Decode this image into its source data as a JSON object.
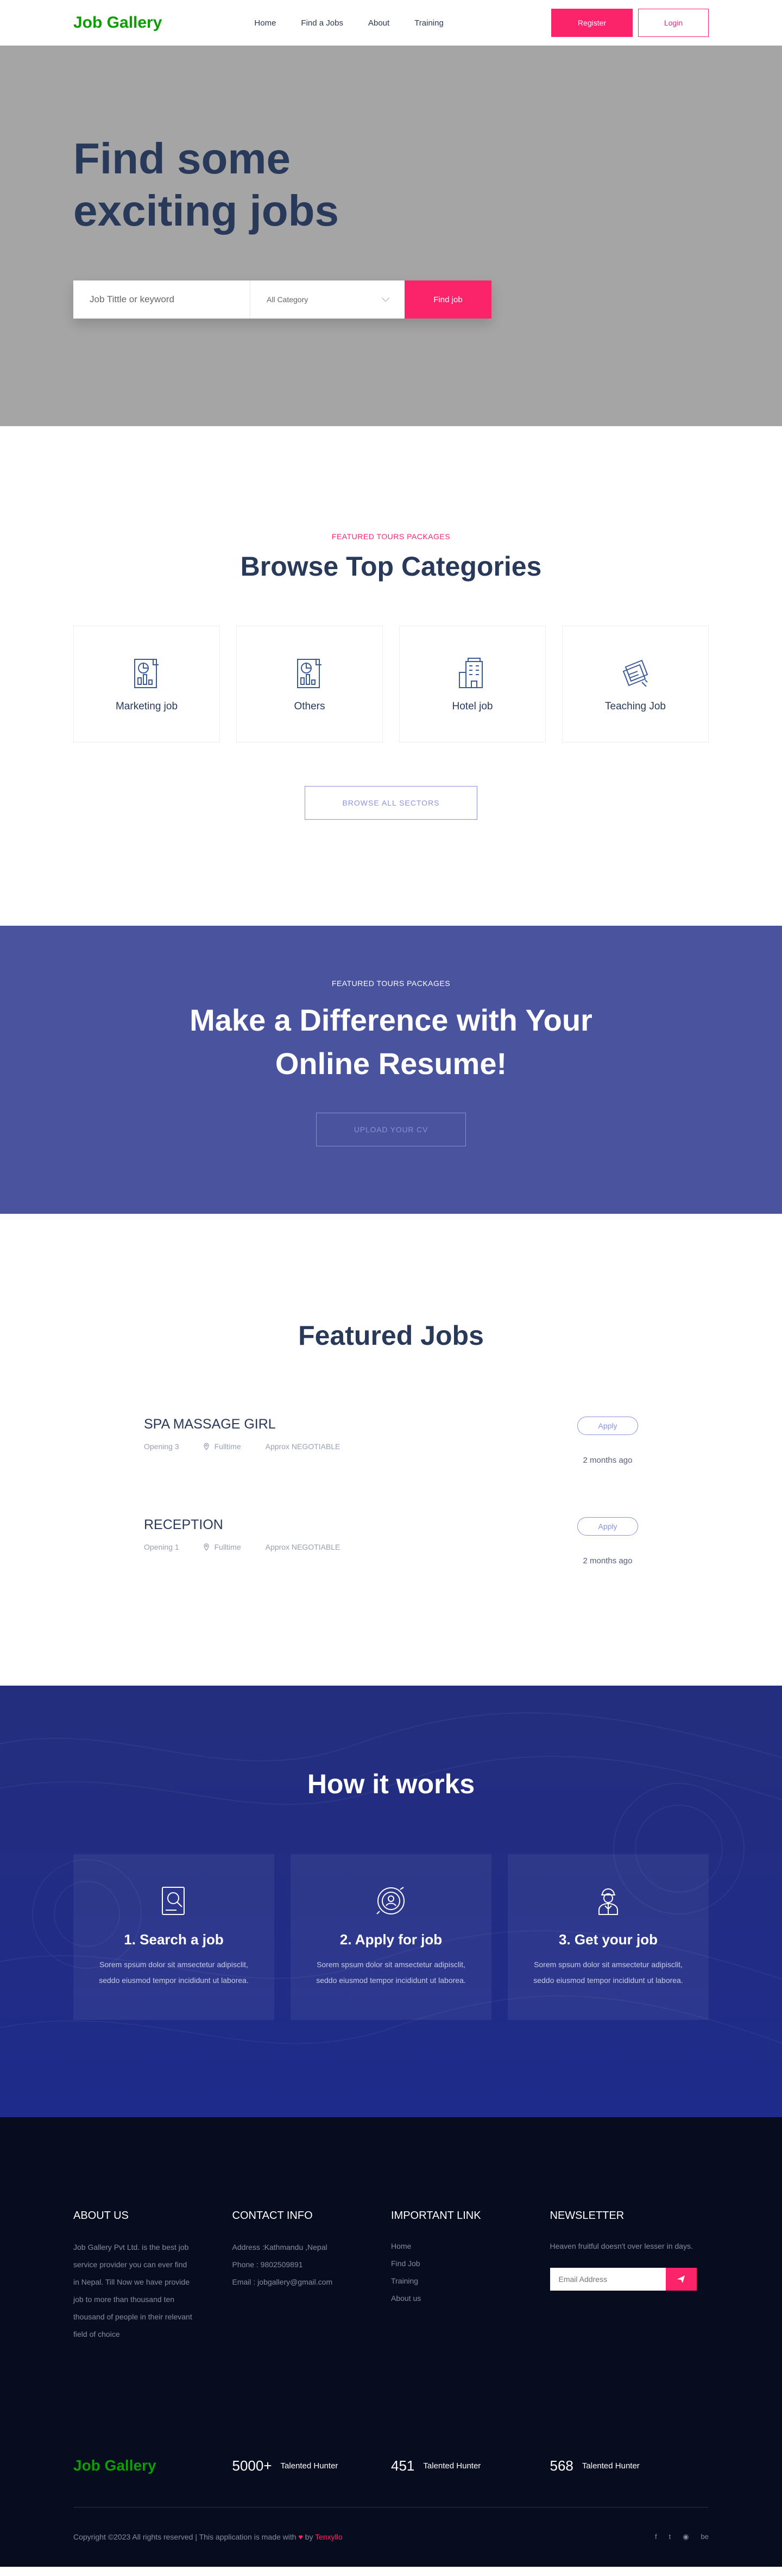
{
  "header": {
    "logo": "Job Gallery",
    "nav": [
      "Home",
      "Find a Jobs",
      "About",
      "Training"
    ],
    "register": "Register",
    "login": "Login"
  },
  "hero": {
    "title_line1": "Find some",
    "title_line2": "exciting jobs",
    "search_placeholder": "Job Tittle or keyword",
    "category_selected": "All Category",
    "find_button": "Find job"
  },
  "categories": {
    "eyebrow": "FEATURED TOURS PACKAGES",
    "title": "Browse Top Categories",
    "items": [
      {
        "label": "Marketing job",
        "icon": "report-icon"
      },
      {
        "label": "Others",
        "icon": "report-icon"
      },
      {
        "label": "Hotel job",
        "icon": "hotel-icon"
      },
      {
        "label": "Teaching Job",
        "icon": "documents-icon"
      }
    ],
    "browse_button": "BROWSE ALL SECTORS"
  },
  "cta": {
    "eyebrow": "FEATURED TOURS PACKAGES",
    "title_line1": "Make a Difference with Your",
    "title_line2": "Online Resume!",
    "upload_button": "UPLOAD YOUR CV"
  },
  "featured": {
    "title": "Featured Jobs",
    "jobs": [
      {
        "title": "SPA MASSAGE GIRL",
        "opening": "Opening 3",
        "type": "Fulltime",
        "salary": "Approx NEGOTIABLE",
        "apply": "Apply",
        "time": "2 months ago"
      },
      {
        "title": "RECEPTION",
        "opening": "Opening 1",
        "type": "Fulltime",
        "salary": "Approx NEGOTIABLE",
        "apply": "Apply",
        "time": "2 months ago"
      }
    ]
  },
  "how": {
    "title": "How it works",
    "steps": [
      {
        "title": "1. Search a job",
        "text": "Sorem spsum dolor sit amsectetur adipisclit, seddo eiusmod tempor incididunt ut laborea.",
        "icon": "search-doc-icon"
      },
      {
        "title": "2. Apply for job",
        "text": "Sorem spsum dolor sit amsectetur adipisclit, seddo eiusmod tempor incididunt ut laborea.",
        "icon": "apply-icon"
      },
      {
        "title": "3. Get your job",
        "text": "Sorem spsum dolor sit amsectetur adipisclit, seddo eiusmod tempor incididunt ut laborea.",
        "icon": "worker-icon"
      }
    ]
  },
  "footer": {
    "about_title": "ABOUT US",
    "about_text": "Job Gallery Pvt Ltd. is the best job service provider you can ever find in Nepal. Till Now we have provide job to more than thousand ten thousand of people in their relevant field of choice",
    "contact_title": "CONTACT INFO",
    "address": "Address :Kathmandu ,Nepal",
    "phone": "Phone : 9802509891",
    "email": "Email : jobgallery@gmail.com",
    "links_title": "IMPORTANT LINK",
    "links": [
      "Home",
      "Find Job",
      "Training",
      "About us"
    ],
    "newsletter_title": "NEWSLETTER",
    "newsletter_text": "Heaven fruitful doesn't over lesser in days.",
    "email_placeholder": "Email Address",
    "logo": "Job Gallery",
    "stats": [
      {
        "num": "5000+",
        "label": "Talented Hunter"
      },
      {
        "num": "451",
        "label": "Talented Hunter"
      },
      {
        "num": "568",
        "label": "Talented Hunter"
      }
    ],
    "copyright": "Copyright ©2023 All rights reserved | This application is made with",
    "by": "by",
    "brand": "Tenxyllo",
    "social": [
      "f",
      "t",
      "◉",
      "be"
    ]
  },
  "colors": {
    "brand_green": "#0a9e01",
    "accent_pink": "#fb246a",
    "navy": "#28395a",
    "cta_blue": "#4a549e",
    "how_blue": "#1e2b8a",
    "footer_bg": "#070c1e"
  }
}
